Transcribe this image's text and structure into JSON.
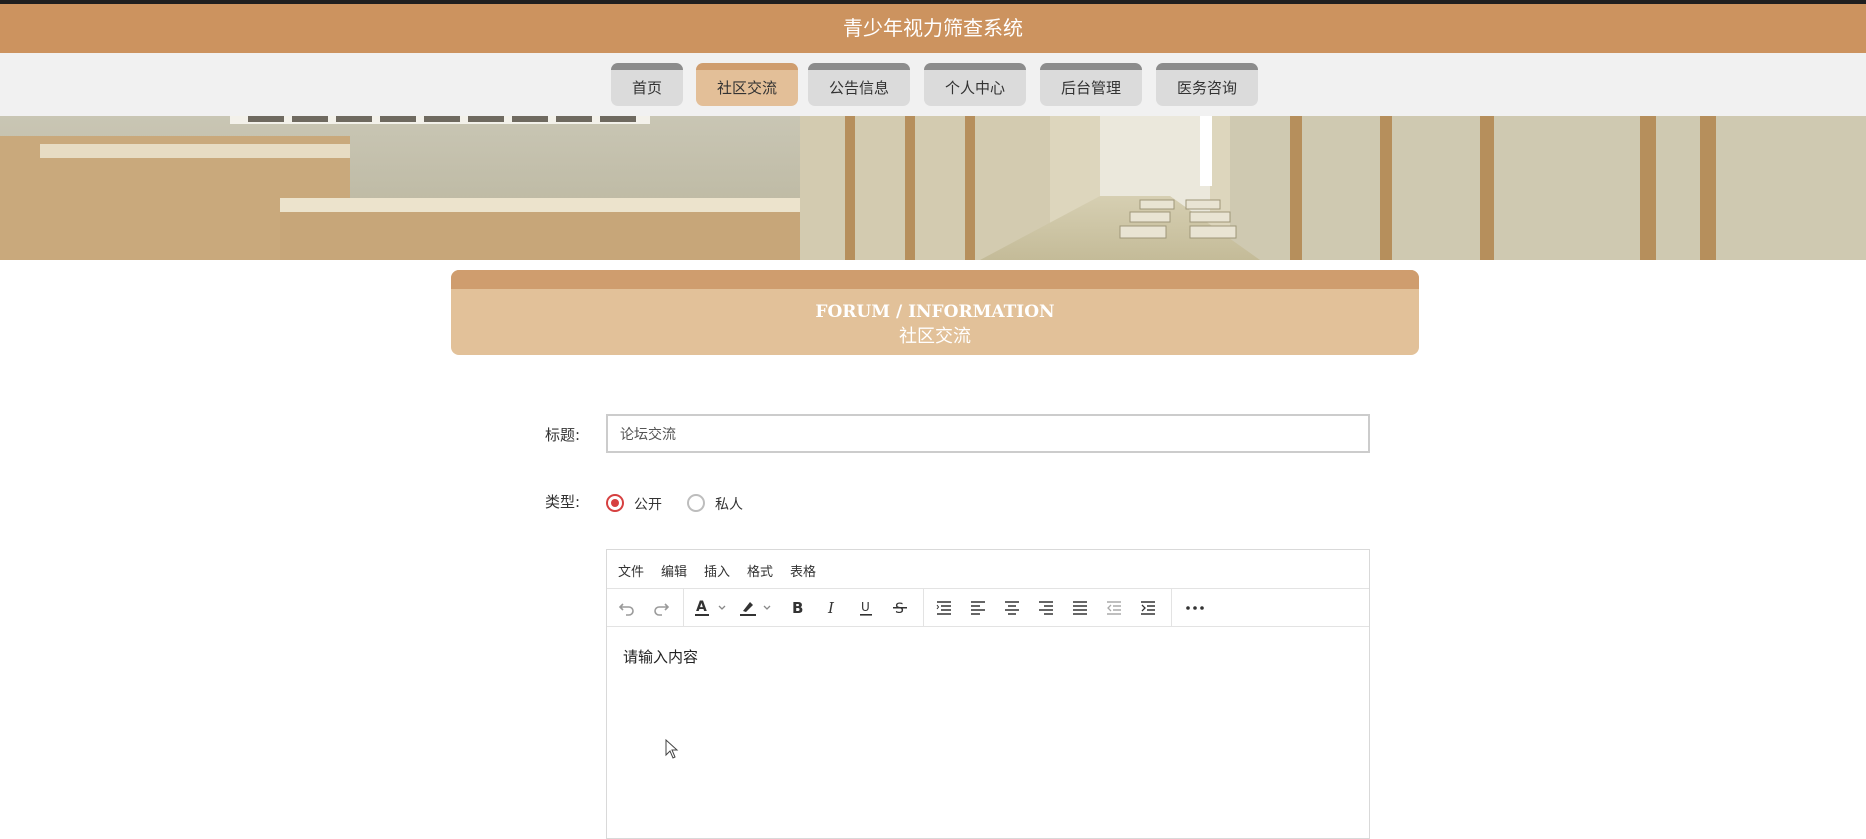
{
  "app": {
    "title": "青少年视力筛查系统"
  },
  "nav": {
    "items": [
      {
        "label": "首页"
      },
      {
        "label": "社区交流"
      },
      {
        "label": "公告信息"
      },
      {
        "label": "个人中心"
      },
      {
        "label": "后台管理"
      },
      {
        "label": "医务咨询"
      }
    ],
    "active": "社区交流"
  },
  "section": {
    "title_en": "FORUM / INFORMATION",
    "title_cn": "社区交流"
  },
  "form": {
    "title_label": "标题:",
    "title_value": "论坛交流",
    "type_label": "类型:",
    "type_options": [
      {
        "label": "公开",
        "selected": true
      },
      {
        "label": "私人",
        "selected": false
      }
    ]
  },
  "editor": {
    "menu": [
      "文件",
      "编辑",
      "插入",
      "格式",
      "表格"
    ],
    "content_placeholder": "请输入内容",
    "toolbar_icons": [
      "undo-icon",
      "redo-icon",
      "text-color-icon",
      "highlight-icon",
      "bold-icon",
      "italic-icon",
      "underline-icon",
      "strikethrough-icon",
      "line-height-icon",
      "align-left-icon",
      "align-center-icon",
      "align-right-icon",
      "justify-icon",
      "outdent-icon",
      "indent-icon",
      "more-icon"
    ]
  },
  "colors": {
    "brand": "#cc935f",
    "tab_active": "#e3bf98",
    "radio_selected": "#d64040"
  }
}
